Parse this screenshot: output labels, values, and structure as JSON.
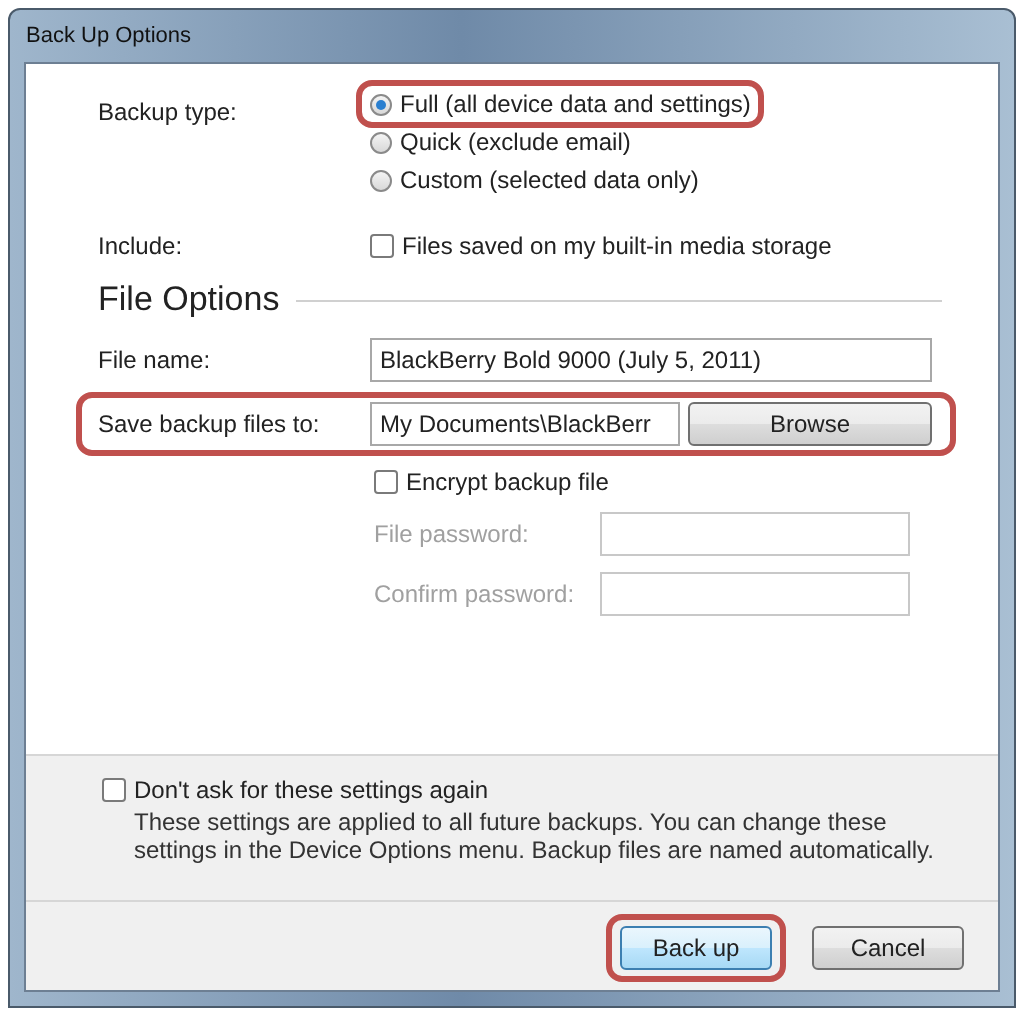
{
  "window": {
    "title": "Back Up Options"
  },
  "backup_type": {
    "label": "Backup type:",
    "options": [
      {
        "label": "Full (all device data and settings)",
        "selected": true,
        "highlighted": true
      },
      {
        "label": "Quick (exclude email)",
        "selected": false,
        "highlighted": false
      },
      {
        "label": "Custom (selected data only)",
        "selected": false,
        "highlighted": false
      }
    ]
  },
  "include": {
    "label": "Include:",
    "checkbox": {
      "label": "Files saved on my built-in media storage",
      "checked": false
    }
  },
  "file_options": {
    "heading": "File Options",
    "fields": [
      {
        "kind": "text",
        "label": "File name:",
        "value": "BlackBerry Bold 9000 (July 5, 2011)",
        "highlighted": false
      },
      {
        "kind": "browse",
        "label": "Save backup files to:",
        "value": "My Documents\\BlackBerr",
        "button": "Browse",
        "highlighted": true
      }
    ],
    "encrypt": {
      "label": "Encrypt backup file",
      "checked": false
    },
    "passwords": [
      {
        "label": "File password:",
        "disabled": true
      },
      {
        "label": "Confirm password:",
        "disabled": true
      }
    ]
  },
  "footer": {
    "dont_ask": {
      "label": "Don't ask for these settings again",
      "checked": false
    },
    "note": "These settings are applied to all future backups. You can change these settings in the Device Options menu. Backup files are named automatically.",
    "buttons": [
      {
        "label": "Back up",
        "default": true,
        "highlighted": true
      },
      {
        "label": "Cancel",
        "default": false,
        "highlighted": false
      }
    ]
  }
}
